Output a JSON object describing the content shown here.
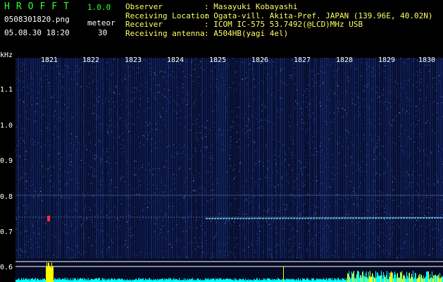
{
  "header": {
    "app_title": "HROFFT",
    "version": "1.0.0",
    "file_name": "0508301820.png",
    "meteor_label": "meteor",
    "datetime": "05.08.30 18:20",
    "meteor_count": "30"
  },
  "station": [
    {
      "key": "Observer",
      "value": ": Masayuki Kobayashi"
    },
    {
      "key": "Receiving Location",
      "value": ": Ogata-vill. Akita-Pref. JAPAN (139.96E, 40.02N)"
    },
    {
      "key": "Receiver",
      "value": ": ICOM IC-575 53.7492(@LCD)MHz USB"
    },
    {
      "key": "Receiving antenna",
      "value": ": A504HB(yagi 4el)"
    }
  ],
  "axis": {
    "unit": "kHz",
    "freq_ticks": [
      "1.1",
      "1.0",
      "0.9",
      "0.8",
      "0.7",
      "0.6"
    ],
    "time_ticks": [
      "1821",
      "1822",
      "1823",
      "1824",
      "1825",
      "1826",
      "1827",
      "1828",
      "1829",
      "1830"
    ]
  },
  "colors": {
    "title": "#33ff33",
    "info_text": "#ffff66",
    "spectrum_bg": "#050a25",
    "echo": "#3a6bff",
    "level_bar": "#ffff00",
    "noise": "#00ffff"
  }
}
